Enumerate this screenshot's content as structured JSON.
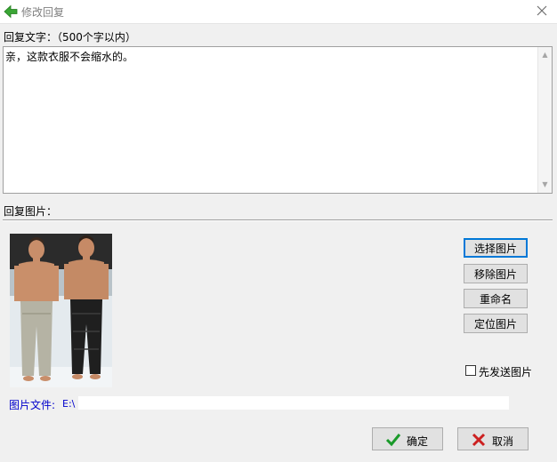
{
  "window": {
    "title": "修改回复",
    "back_icon": "green-back-arrow-icon",
    "close_icon": "close-icon"
  },
  "reply_text": {
    "label": "回复文字：（500个字以内）",
    "value": "亲，这款衣服不会缩水的。"
  },
  "reply_image": {
    "label": "回复图片：",
    "preview": "two male models in pants on a runway"
  },
  "buttons": {
    "select_image": "选择图片",
    "remove_image": "移除图片",
    "rename": "重命名",
    "locate_image": "定位图片",
    "send_image_first": "先发送图片",
    "send_image_first_checked": false,
    "confirm": "确定",
    "cancel": "取消"
  },
  "file": {
    "label": "图片文件:",
    "path": "E:\\"
  },
  "colors": {
    "accent": "#0078d7",
    "confirm_icon": "#1a9a2a",
    "cancel_icon": "#cc2020",
    "file_label": "#0000cc"
  }
}
